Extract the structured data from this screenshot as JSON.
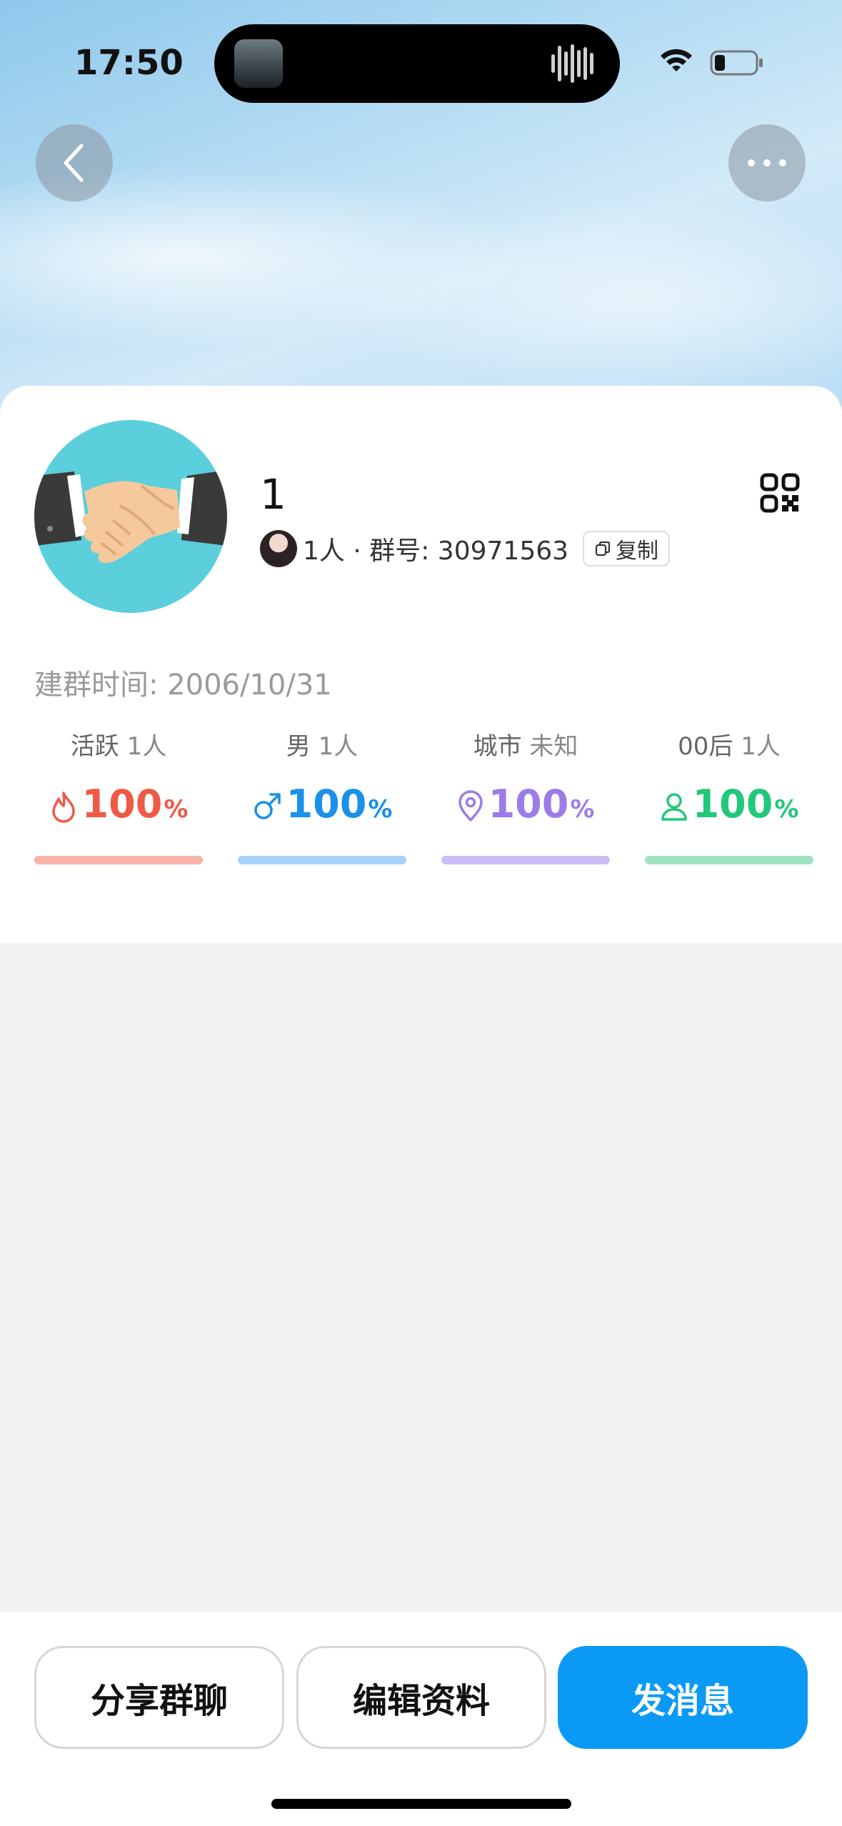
{
  "status_bar": {
    "time": "17:50"
  },
  "header": {
    "back_icon": "chevron-left-icon",
    "more_icon": "ellipsis-icon"
  },
  "group": {
    "name": "1",
    "avatar_icon": "handshake-icon",
    "meta_text": "1人 · 群号: 30971563",
    "copy_label": "复制",
    "qr_icon": "qr-code-icon",
    "created_text": "建群时间: 2006/10/31"
  },
  "stats": [
    {
      "label": "活跃",
      "detail": "1人",
      "value": "100",
      "unit": "%",
      "icon": "flame-icon",
      "color": "#ee5a45",
      "bar_color": "#f7b3a8"
    },
    {
      "label": "男",
      "detail": "1人",
      "value": "100",
      "unit": "%",
      "icon": "male-icon",
      "color": "#1a90e8",
      "bar_color": "#a8d1f7"
    },
    {
      "label": "城市",
      "detail": "未知",
      "value": "100",
      "unit": "%",
      "icon": "location-pin-icon",
      "color": "#9b7ce8",
      "bar_color": "#cdbdf6"
    },
    {
      "label": "00后",
      "detail": "1人",
      "value": "100",
      "unit": "%",
      "icon": "person-icon",
      "color": "#21c87a",
      "bar_color": "#9fe3c0"
    }
  ],
  "actions": {
    "share": "分享群聊",
    "edit": "编辑资料",
    "message": "发消息"
  },
  "colors": {
    "primary": "#0a9af5",
    "page_bg": "#f0f1f3"
  }
}
